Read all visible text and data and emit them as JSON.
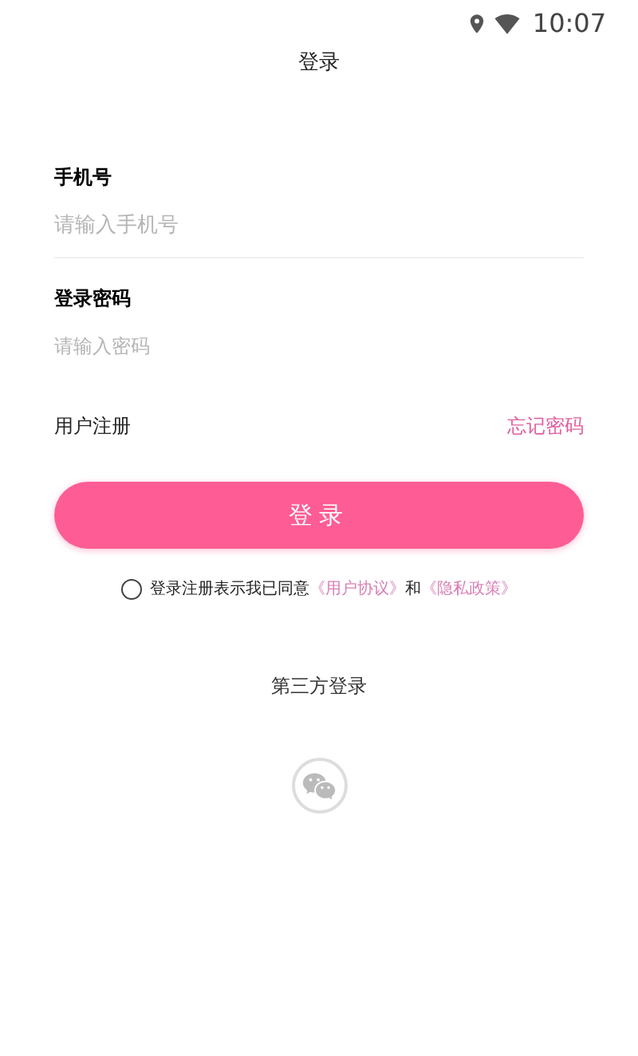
{
  "status_bar": {
    "time": "10:07"
  },
  "title": "登录",
  "fields": [
    {
      "label": "手机号",
      "placeholder": "请输入手机号",
      "kind": "phone"
    },
    {
      "label": "登录密码",
      "placeholder": "请输入密码",
      "kind": "password"
    }
  ],
  "register_link": "用户注册",
  "forgot_link": "忘记密码",
  "login_button": "登录",
  "agreement": {
    "checked": false,
    "text": "登录注册表示我已同意",
    "link_1": "《用户协议》",
    "joiner": "和",
    "link_2": "《隐私政策》"
  },
  "third_party": {
    "title": "第三方登录"
  }
}
